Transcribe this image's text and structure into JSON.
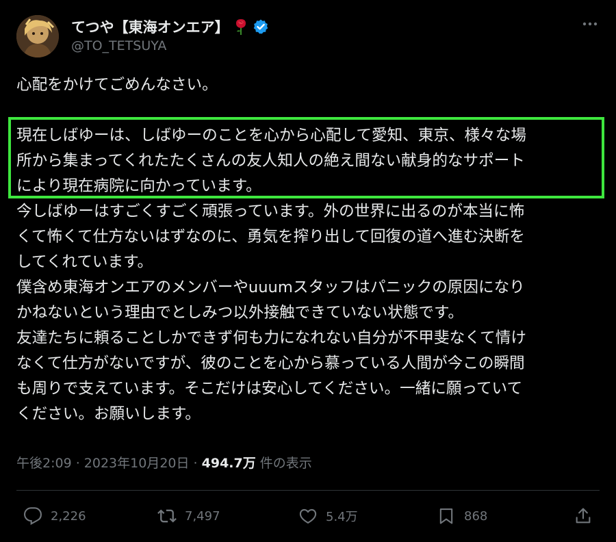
{
  "author": {
    "display_name": "てつや【東海オンエア】",
    "handle": "@TO_TETSUYA"
  },
  "tweet": {
    "lines_intro": [
      "心配をかけてごめんなさい。"
    ],
    "lines_highlight": [
      "現在しばゆーは、しばゆーのことを心から心配して愛知、東京、様々な場",
      "所から集まってくれたたくさんの友人知人の絶え間ない献身的なサポート",
      "により現在病院に向かっています。"
    ],
    "lines_rest": [
      "今しばゆーはすごくすごく頑張っています。外の世界に出るのが本当に怖",
      "くて怖くて仕方ないはずなのに、勇気を搾り出して回復の道へ進む決断を",
      "してくれています。",
      "僕含め東海オンエアのメンバーやuuumスタッフはパニックの原因になり",
      "かねないという理由でとしみつ以外接触できていない状態です。",
      "友達たちに頼ることしかできず何も力になれない自分が不甲斐なくて情け",
      "なくて仕方がないですが、彼のことを心から慕っている人間が今この瞬間",
      "も周りで支えています。そこだけは安心してください。一緒に願っていて",
      "ください。お願いします。"
    ]
  },
  "meta": {
    "time": "午後2:09",
    "separator": " · ",
    "date": "2023年10月20日",
    "views_count": "494.7万",
    "views_label": " 件の表示"
  },
  "actions": {
    "reply_count": "2,226",
    "repost_count": "7,497",
    "like_count": "5.4万",
    "bookmark_count": "868"
  },
  "colors": {
    "background": "#000000",
    "text": "#e7e9ea",
    "secondary": "#71767b",
    "verified": "#1d9bf0",
    "highlight_border": "#3ee63e"
  },
  "icons": [
    "rose-icon",
    "verified-badge-icon",
    "more-icon",
    "reply-icon",
    "repost-icon",
    "like-icon",
    "bookmark-icon",
    "share-icon"
  ]
}
